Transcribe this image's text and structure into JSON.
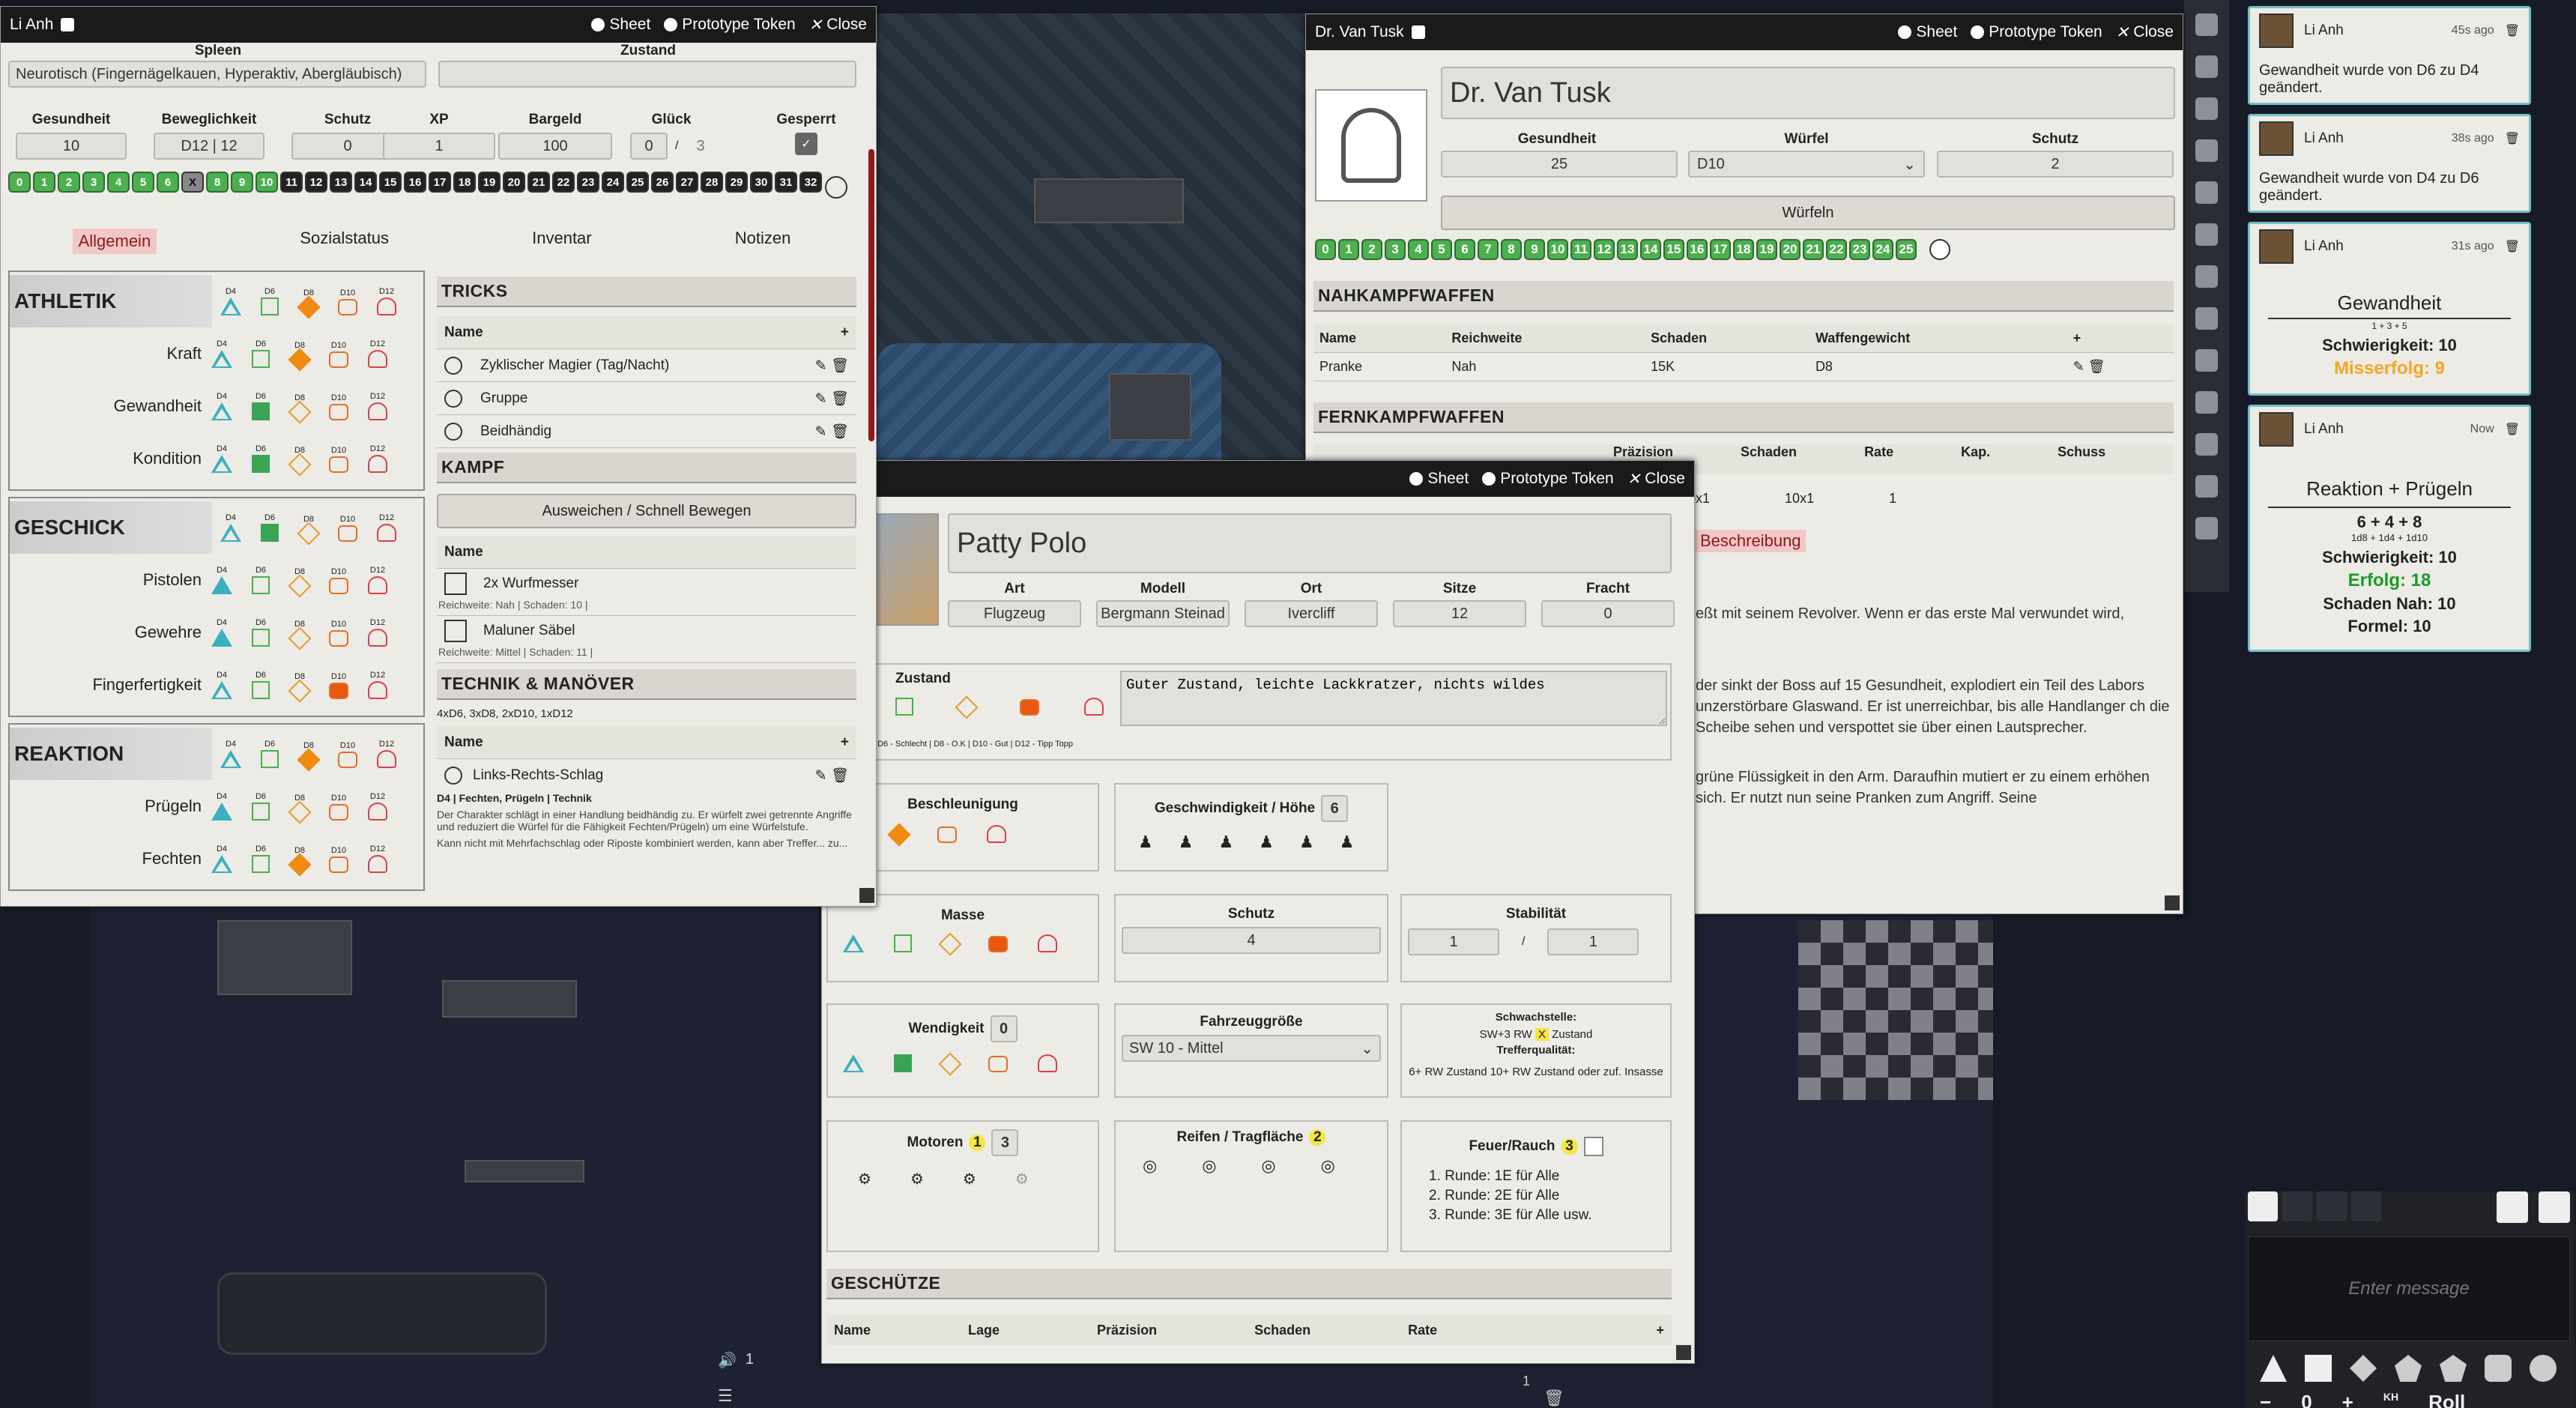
{
  "li_anh": {
    "title": "Li Anh",
    "actions": {
      "sheet": "Sheet",
      "prototype": "Prototype Token",
      "close": "Close"
    },
    "spleen_label": "Spleen",
    "spleen_value": "Neurotisch (Fingernägelkauen, Hyperaktiv, Abergläubisch)",
    "zustand_label": "Zustand",
    "zustand_value": "",
    "stats": [
      {
        "label": "Gesundheit",
        "value": "10"
      },
      {
        "label": "Beweglichkeit",
        "value": "D12 | 12"
      },
      {
        "label": "Schutz",
        "value": "0"
      },
      {
        "label": "XP",
        "value": "1"
      },
      {
        "label": "Bargeld",
        "value": "100"
      },
      {
        "label": "Glück",
        "value": "0",
        "max": "3"
      },
      {
        "label": "Gesperrt",
        "value": "✓"
      }
    ],
    "track": [
      "0",
      "1",
      "2",
      "3",
      "4",
      "5",
      "6",
      "X",
      "8",
      "9",
      "10",
      "11",
      "12",
      "13",
      "14",
      "15",
      "16",
      "17",
      "18",
      "19",
      "20",
      "21",
      "22",
      "23",
      "24",
      "25",
      "26",
      "27",
      "28",
      "29",
      "30",
      "31",
      "32"
    ],
    "tabs": [
      "Allgemein",
      "Sozialstatus",
      "Inventar",
      "Notizen"
    ],
    "die_labels": [
      "D4",
      "D6",
      "D8",
      "D10",
      "D12"
    ],
    "attributes": [
      {
        "name": "ATHLETIK",
        "skills": [
          "Kraft",
          "Gewandheit",
          "Kondition"
        ]
      },
      {
        "name": "GESCHICK",
        "skills": [
          "Pistolen",
          "Gewehre",
          "Fingerfertigkeit"
        ]
      },
      {
        "name": "REAKTION",
        "skills": [
          "Prügeln",
          "Fechten"
        ]
      }
    ],
    "tricks_title": "TRICKS",
    "col_name": "Name",
    "tricks": [
      "Zyklischer Magier (Tag/Nacht)",
      "Gruppe",
      "Beidhändig"
    ],
    "kampf_title": "KAMPF",
    "kampf_button": "Ausweichen / Schnell Bewegen",
    "weapons": [
      {
        "name": "2x Wurfmesser",
        "info": "Reichweite: Nah | Schaden: 10 |"
      },
      {
        "name": "Maluner Säbel",
        "info": "Reichweite: Mittel | Schaden: 11 |"
      }
    ],
    "technik_title": "TECHNIK & MANÖVER",
    "technik_dice": "4xD6, 3xD8, 2xD10, 1xD12",
    "technik_item": "Links-Rechts-Schlag",
    "technik_tags": "D4 | Fechten, Prügeln | Technik",
    "technik_desc": "Der Charakter schlägt in einer Handlung beidhändig zu. Er würfelt zwei getrennte Angriffe und reduziert die Würfel für die Fähigkeit Fechten/Prügeln) um eine Würfelstufe.",
    "technik_desc2": "Kann nicht mit Mehrfachschlag oder Riposte kombiniert werden, kann aber Treffer... zu..."
  },
  "van_tusk": {
    "title": "Dr. Van Tusk",
    "actions": {
      "sheet": "Sheet",
      "prototype": "Prototype Token",
      "close": "Close"
    },
    "name": "Dr. Van Tusk",
    "health_label": "Gesundheit",
    "health": "25",
    "dice_label": "Würfel",
    "dice": "D10",
    "schutz_label": "Schutz",
    "schutz": "2",
    "roll": "Würfeln",
    "track": [
      "0",
      "1",
      "2",
      "3",
      "4",
      "5",
      "6",
      "7",
      "8",
      "9",
      "10",
      "11",
      "12",
      "13",
      "14",
      "15",
      "16",
      "17",
      "18",
      "19",
      "20",
      "21",
      "22",
      "23",
      "24",
      "25"
    ],
    "melee_title": "NAHKAMPFWAFFEN",
    "melee_cols": [
      "Name",
      "Reichweite",
      "Schaden",
      "Waffengewicht"
    ],
    "melee_rows": [
      [
        "Pranke",
        "Nah",
        "15K",
        "D8"
      ]
    ],
    "ranged_title": "FERNKAMPFWAFFEN",
    "ranged_cols": [
      "Präzision",
      "Schaden",
      "Rate",
      "Kap.",
      "Schuss"
    ],
    "ranged_row": [
      "10x1",
      "10x1",
      "1"
    ],
    "desc_title": "Beschreibung",
    "desc1": "eßt mit seinem Revolver. Wenn er das erste Mal verwundet wird,",
    "desc2": "der sinkt der Boss auf 15 Gesundheit, explodiert ein Teil des Labors unzerstörbare Glaswand. Er ist unerreichbar, bis alle Handlanger ch die Scheibe sehen und verspottet sie über einen Lautsprecher.",
    "desc3": "grüne Flüssigkeit in den Arm. Daraufhin mutiert er zu einem erhöhen sich. Er nutzt nun seine Pranken zum Angriff. Seine"
  },
  "patty": {
    "title": "olo",
    "actions": {
      "sheet": "Sheet",
      "prototype": "Prototype Token",
      "close": "Close"
    },
    "name": "Patty Polo",
    "fields": [
      {
        "label": "Art",
        "value": "Flugzeug"
      },
      {
        "label": "Modell",
        "value": "Bergmann Steinad"
      },
      {
        "label": "Ort",
        "value": "Ivercliff"
      },
      {
        "label": "Sitze",
        "value": "12"
      },
      {
        "label": "Fracht",
        "value": "0"
      }
    ],
    "zustand_label": "Zustand",
    "zustand_text": "Guter Zustand, leichte Lackkratzer, nichts wildes",
    "zustand_legend": "icht | D6 - Schlecht | D8 - O.K | D10 - Gut | D12 - Tipp Topp",
    "beschl_label": "Beschleunigung",
    "speed_label": "Geschwindigkeit / Höhe",
    "speed_value": "6",
    "masse_label": "Masse",
    "schutz_label": "Schutz",
    "schutz_value": "4",
    "stab_label": "Stabilität",
    "stab_a": "1",
    "stab_b": "1",
    "wendig_label": "Wendigkeit",
    "wendig_value": "0",
    "size_label": "Fahrzeuggröße",
    "size_value": "SW 10 - Mittel",
    "weak_label": "Schwachstelle:",
    "weak_text_a": "SW+3 RW",
    "weak_mark": "X",
    "weak_text_b": "Zustand",
    "hit_label": "Trefferqualität:",
    "hit_text": "6+ RW Zustand 10+ RW Zustand oder zuf. Insasse",
    "motor_label": "Motoren",
    "motor_badge": "1",
    "motor_value": "3",
    "tires_label": "Reifen / Tragfläche",
    "tires_badge": "2",
    "fire_label": "Feuer/Rauch",
    "fire_badge": "3",
    "fire_rules": [
      "1. Runde: 1E für Alle",
      "2. Runde: 2E für Alle",
      "3. Runde: 3E für Alle usw."
    ],
    "guns_title": "GESCHÜTZE",
    "guns_cols": [
      "Name",
      "Lage",
      "Präzision",
      "Schaden",
      "Rate"
    ]
  },
  "chat": [
    {
      "who": "Li Anh",
      "time": "45s ago",
      "text": "Gewandheit wurde von D6 zu D4 geändert."
    },
    {
      "who": "Li Anh",
      "time": "38s ago",
      "text": "Gewandheit wurde von D4 zu D6 geändert."
    },
    {
      "who": "Li Anh",
      "time": "31s ago",
      "roll_title": "Gewandheit",
      "roll_formula": "1 + 3 + 5",
      "diff": "Schwierigkeit: 10",
      "result": "Misserfolg: 9"
    },
    {
      "who": "Li Anh",
      "time": "Now",
      "roll_title": "Reaktion + Prügeln",
      "roll_sum": "6 + 4 + 8",
      "roll_formula": "1d8 + 1d4 + 1d10",
      "diff": "Schwierigkeit: 10",
      "result": "Erfolg: 18",
      "dmg": "Schaden Nah: 10",
      "formula": "Formel: 10"
    }
  ],
  "chat_input_placeholder": "Enter message",
  "bottom_counter": "0",
  "bottom_roll": "Roll",
  "bottom_kh": "KH",
  "map_bottom": {
    "vol": "1",
    "page": "1"
  },
  "colors": {
    "accent": "#74c0c7",
    "green": "#4caf50",
    "orange": "#f08a10",
    "fail": "#f5a623",
    "success": "#1a9b2a"
  }
}
